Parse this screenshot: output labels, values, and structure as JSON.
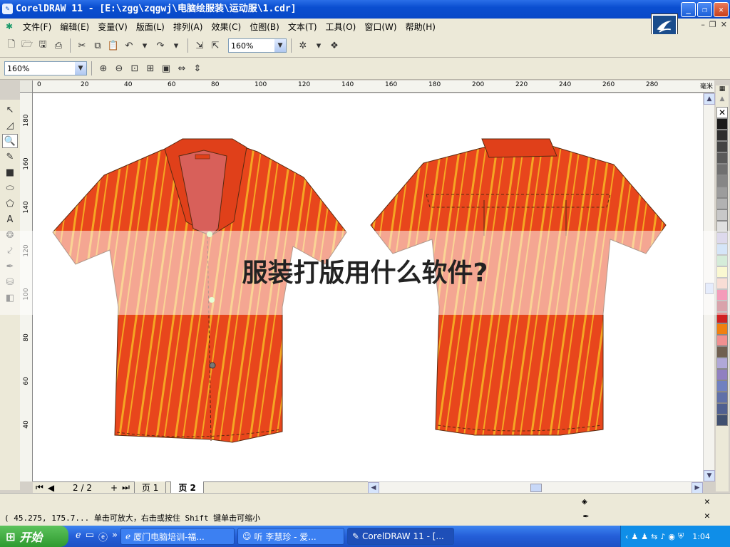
{
  "window": {
    "title": "CorelDRAW 11 - [E:\\zgg\\zqgwj\\电脑绘服装\\运动服\\1.cdr]"
  },
  "menu": [
    "文件(F)",
    "编辑(E)",
    "变量(V)",
    "版面(L)",
    "排列(A)",
    "效果(C)",
    "位图(B)",
    "文本(T)",
    "工具(O)",
    "窗口(W)",
    "帮助(H)"
  ],
  "toolbar": {
    "zoom_value": "160%"
  },
  "zoombar": {
    "zoom_value": "160%"
  },
  "ruler": {
    "unit": "毫米",
    "h_ticks": [
      "0",
      "20",
      "40",
      "60",
      "80",
      "100",
      "120",
      "140",
      "160",
      "180",
      "200",
      "220",
      "240",
      "260",
      "280"
    ],
    "v_ticks": [
      "180",
      "160",
      "140",
      "120",
      "100",
      "80",
      "60",
      "40"
    ]
  },
  "overlay": {
    "title": "服装打版用什么软件?"
  },
  "pages": {
    "counter": "2 / 2",
    "tab1": "页 1",
    "tab2": "页 2"
  },
  "status": {
    "text": "( 45.275, 175.7...   单击可放大，右击或按住 Shift 键单击可缩小"
  },
  "taskbar": {
    "start": "开始",
    "tasks": [
      "厦门电脑培训-福...",
      "听  李慧珍 - 爱...",
      "CorelDRAW 11 - [..."
    ],
    "clock": "1:04"
  },
  "palette_colors": [
    "#ffffff",
    "#1a1a1a",
    "#2e2e2e",
    "#444444",
    "#5a5a5a",
    "#707070",
    "#868686",
    "#9c9c9c",
    "#b2b2b2",
    "#c8c8c8",
    "#e0e0e0",
    "#b8b0d8",
    "#a8c8f0",
    "#a8d8b0",
    "#f4f0a0",
    "#f0b8a8",
    "#e83070",
    "#b04050",
    "#d02020",
    "#f08010",
    "#f09090",
    "#706050",
    "#b0a8d8",
    "#9080c0",
    "#7080c0",
    "#6070a8",
    "#506090",
    "#405070"
  ],
  "colors": {
    "shirt": "#e8461c",
    "stripe": "#f5a623",
    "collar": "#e0401a",
    "placket": "#d8605a"
  }
}
